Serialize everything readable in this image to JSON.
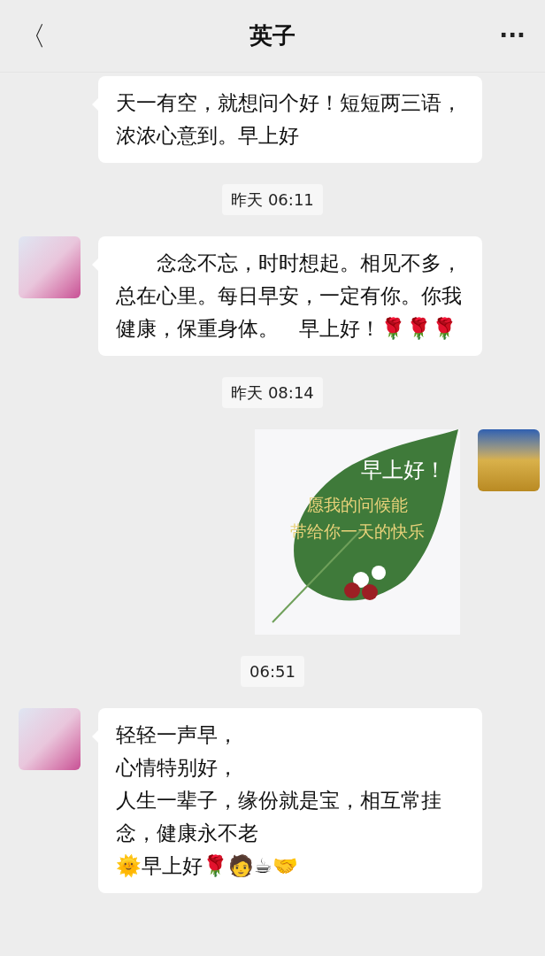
{
  "header": {
    "back": "〈",
    "title": "英子",
    "more": "···"
  },
  "messages": [
    {
      "kind": "text",
      "outgoing": false,
      "avatar": false,
      "lines": [
        "天一有空，就想问个好！短短两三语，浓浓心意到。早上好"
      ]
    },
    {
      "kind": "time",
      "text": "昨天 06:11"
    },
    {
      "kind": "text",
      "outgoing": false,
      "avatar": true,
      "lines": [
        "　　念念不忘，时时想起。相见不多，总在心里。每日早安，一定有你。你我健康，保重身体。　早上好！🌹🌹🌹"
      ]
    },
    {
      "kind": "time",
      "text": "昨天 08:14"
    },
    {
      "kind": "image",
      "outgoing": true,
      "avatar": true,
      "lines": [
        "早上好！",
        "愿我的问候能",
        "带给你一天的快乐"
      ]
    },
    {
      "kind": "time",
      "text": "06:51"
    },
    {
      "kind": "text",
      "outgoing": false,
      "avatar": true,
      "lines": [
        "轻轻一声早，",
        "心情特别好，",
        "人生一辈子，缘份就是宝，相互常挂念，健康永不老",
        "🌞早上好🌹🧑☕🤝"
      ]
    }
  ]
}
